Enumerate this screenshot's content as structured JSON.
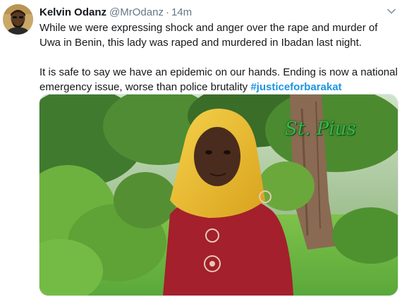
{
  "tweet": {
    "author_name": "Kelvin Odanz",
    "author_handle": "@MrOdanz",
    "separator": "·",
    "timestamp": "14m",
    "paragraph1": "While we were expressing shock and anger over the rape and murder of Uwa in Benin, this lady was raped and murdered in Ibadan last night.",
    "paragraph2_text": "It is safe to say we have an epidemic on our hands. Ending is now a national emergency issue, worse than police brutality ",
    "hashtag": "#justiceforbarakat"
  },
  "media": {
    "watermark_text": "St. Pius"
  },
  "icons": {
    "menu": "chevron-down-icon"
  },
  "colors": {
    "link": "#1b95e0",
    "secondary_text": "#657786",
    "primary_text": "#14171a"
  }
}
